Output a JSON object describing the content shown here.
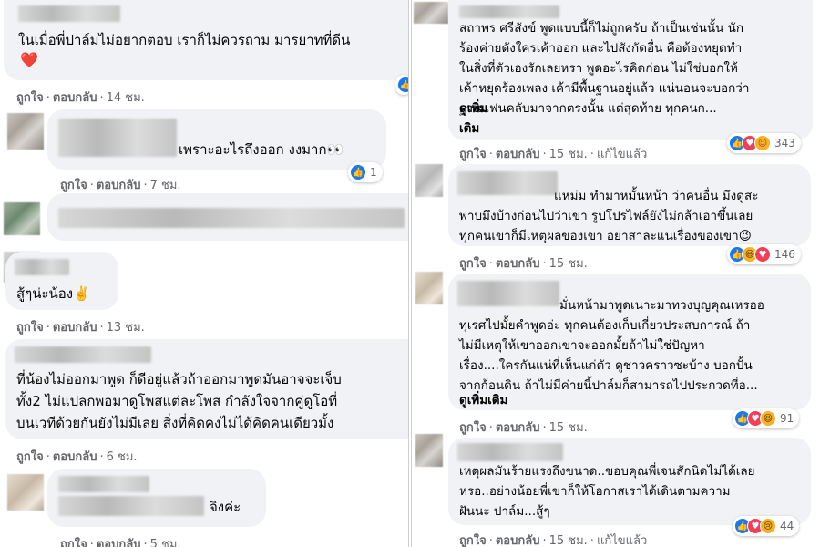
{
  "left_panel": {
    "comments": [
      {
        "text": "ในเมื่อพี่ปาล์มไม่อยากตอบ เราก็ไม่ควรถาม มารยาทที่ดีน",
        "emoji": "❤️",
        "actions": {
          "like": "ถูกใจ",
          "reply": "ตอบกลับ",
          "time": "14 ชม."
        }
      },
      {
        "text": "เพราะอะไรถึงออก งงมาก👀",
        "reaction_count": "1",
        "actions": {
          "like": "ถูกใจ",
          "reply": "ตอบกลับ",
          "time": "7 ชม."
        }
      },
      {
        "text": "สู้ๆน่ะน้อง✌️",
        "actions": {
          "like": "ถูกใจ",
          "reply": "ตอบกลับ",
          "time": "13 ชม."
        }
      },
      {
        "text": "ที่น้องไม่ออกมาพูด ก็ดีอยู่แล้วถ้าออกมาพูดมันอาจจะเจ็บ\nทั้ง2 ไม่แปลกพอมาดูโพสแต่ละโพส กำลังใจจากคู่ดูโอที่\nบนเวทีด้วยกันยังไม่มีเลย สิ่งที่คิดคงไม่ได้คิดคนเดียวมั้ง",
        "actions": {
          "like": "ถูกใจ",
          "reply": "ตอบกลับ",
          "time": "6 ชม."
        }
      },
      {
        "text": "จิงค่ะ",
        "actions": {
          "like": "ถูกใจ",
          "reply": "ตอบกลับ",
          "time": "5 ชม."
        }
      }
    ]
  },
  "right_panel": {
    "comments": [
      {
        "text": "สถาพร ศรีสังข์ พูดแบบนี้ก็ไม่ถูกครับ ถ้าเป็นเช่นนั้น นัก\nร้องค่ายดังใครเค้าออก และไปสังกัดอื่น คือต้องหยุดทำ\nในสิ่งที่ตัวเองรักเลยหรา พูดอะไรคิดก่อน ไม่ใช่บอกให้\nเค้าหยุดร้องเพลง เค้ามีพื้นฐานอยู่แล้ว แน่นอนจะบอกว่า\nฐานแฟนคลับมาจากตรงนั้น แต่สุดท้าย ทุกคนก...",
        "see_more": "ดูเพิ่ม\nเติม",
        "reaction_count": "343",
        "actions": {
          "like": "ถูกใจ",
          "reply": "ตอบกลับ",
          "time": "15 ชม.",
          "edited": "แก้ไขแล้ว"
        }
      },
      {
        "text": "แหม่ม ทำมาหมั้นหน้า ว่าคนอื่น มึงดูสะ\nพาบมึงบ้างก่อนไปว่าเขา รูปโปรไฟล์ยังไม่กล้าเอาขึ้นเลย\nทุกคนเขาก็มีเหตุผลของเขา อย่าสาละแน่เรื่องของเขา😉",
        "reaction_count": "146",
        "actions": {
          "like": "ถูกใจ",
          "reply": "ตอบกลับ",
          "time": "15 ชม."
        }
      },
      {
        "text": "มั่นหน้ามาพูดเนาะมาทวงบุญคุณเหรออ\nทุเรศไปมั้ยคำพูดอ่ะ ทุกคนต้องเก็บเกี่ยวประสบการณ์ ถ้า\nไม่มีเหตุให้เขาออกเขาจะออกมั้ยถ้าไม่ใช่ปัญหา\nเรื่อง....ใครกันแน่ที่เห็นแก่ตัว ดูชาวคราวซะบ้าง บอกปั้น\nจากก้อนดิน ถ้าไม่มีค่ายนี้ปาล์มก็สามารถไปประกวดที่อ...",
        "see_more": "ดูเพิ่มเติม",
        "reaction_count": "91",
        "actions": {
          "like": "ถูกใจ",
          "reply": "ตอบกลับ",
          "time": "15 ชม."
        }
      },
      {
        "text": "เหตุผลมันร้ายแรงถึงขนาด..ขอบคุณพี่เจนสักนิดไม่ได้เลย\nหรอ..อย่างน้อยพี่เขาก็ให้โอกาสเราได้เดินตามความ\nฝันนะ ปาล์ม...สู้ๆ",
        "reaction_count": "44",
        "actions": {
          "like": "ถูกใจ",
          "reply": "ตอบกลับ",
          "time": "15 ชม.",
          "edited": "แก้ไขแล้ว"
        }
      }
    ]
  },
  "colors": {
    "bubble": "#f0f2f5",
    "meta_text": "#65676b",
    "like_blue": "#1877f2",
    "love_red": "#f33e58",
    "emoji_yellow": "#f7b125"
  }
}
